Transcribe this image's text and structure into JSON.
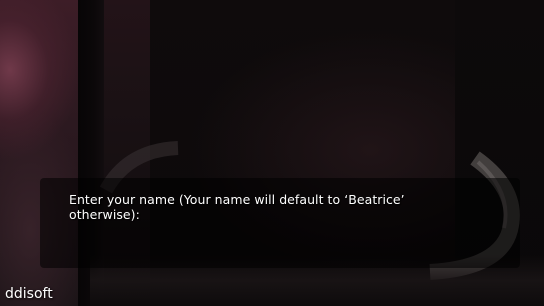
{
  "dialog": {
    "prompt": "Enter your name (Your name will default to ‘Beatrice’ otherwise):"
  },
  "watermark": {
    "text": "ddisoft"
  },
  "colors": {
    "text": "#ffffff",
    "background": "#0b0809",
    "left_glow": "#7a3e50"
  }
}
